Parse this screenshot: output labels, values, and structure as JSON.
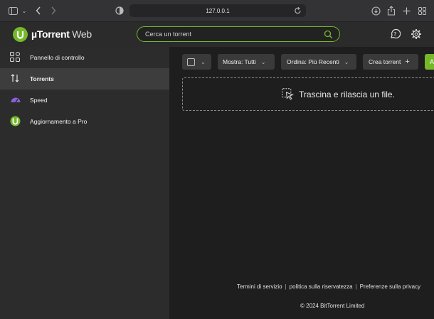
{
  "browser": {
    "url": "127.0.0.1",
    "icons": [
      "sidebar-toggle-icon",
      "back-icon",
      "forward-icon",
      "privacy-shield-icon",
      "reload-icon",
      "download-icon",
      "share-icon",
      "new-tab-icon",
      "tab-overview-icon"
    ]
  },
  "app": {
    "logo_brand": "µTorrent",
    "logo_suffix": " Web",
    "search_placeholder": "Cerca un torrent",
    "accent_color": "#76b82a"
  },
  "sidebar": {
    "items": [
      {
        "label": "Pannello di controllo",
        "icon": "dashboard-icon",
        "active": false
      },
      {
        "label": "Torrents",
        "icon": "transfer-arrows-icon",
        "active": true
      },
      {
        "label": "Speed",
        "icon": "speedometer-icon",
        "active": false
      },
      {
        "label": "Aggiornamento a Pro",
        "icon": "utorrent-logo-icon",
        "active": false
      }
    ]
  },
  "toolbar": {
    "show_label": "Mostra: Tutti",
    "sort_label": "Ordina: Più Recenti",
    "create_label": "Crea torrent",
    "add_label": "A"
  },
  "dropzone": {
    "text": "Trascina e rilascia un file."
  },
  "footer": {
    "terms": "Termini di servizio",
    "privacy": "politica sulla riservatezza",
    "preferences": "Preferenze sulla privacy",
    "separator": "|",
    "copyright": "© 2024 BitTorrent Limited"
  }
}
